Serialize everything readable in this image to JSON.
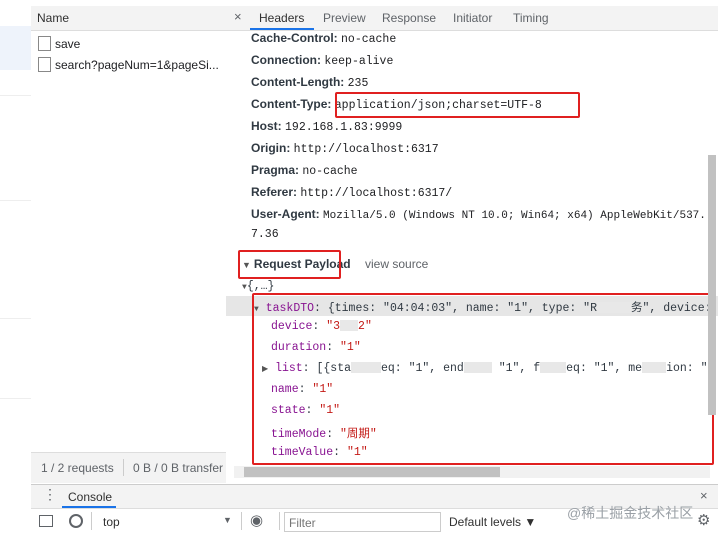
{
  "network_list": {
    "column_header": "Name",
    "requests": [
      {
        "name": "save"
      },
      {
        "name": "search?pageNum=1&pageSi..."
      }
    ],
    "footer_count": "1 / 2 requests",
    "footer_transfer": "0 B / 0 B transfer"
  },
  "tabs": [
    "Headers",
    "Preview",
    "Response",
    "Initiator",
    "Timing"
  ],
  "active_tab": "Headers",
  "close_glyph": "×",
  "headers": [
    {
      "key": "Cache-Control:",
      "value": "no-cache"
    },
    {
      "key": "Connection:",
      "value": "keep-alive"
    },
    {
      "key": "Content-Length:",
      "value": "235"
    },
    {
      "key": "Content-Type:",
      "value": "application/json;charset=UTF-8"
    },
    {
      "key": "Host:",
      "value": "192.168.1.83:9999"
    },
    {
      "key": "Origin:",
      "value": "http://localhost:6317"
    },
    {
      "key": "Pragma:",
      "value": "no-cache"
    },
    {
      "key": "Referer:",
      "value": "http://localhost:6317/"
    },
    {
      "key": "User-Agent:",
      "value": "Mozilla/5.0 (Windows NT 10.0; Win64; x64) AppleWebKit/537.",
      "value_cont": "7.36"
    }
  ],
  "payload": {
    "title": "Request Payload",
    "view_source": "view source",
    "root": "{,…}",
    "task_key": "taskDTO",
    "task_summary": "{times: \"04:04:03\", name: \"1\", type: \"R",
    "task_summary_tail": "务\", device: \"新",
    "fields": [
      {
        "key": "device",
        "value": "\"3",
        "value_tail": "2\""
      },
      {
        "key": "duration",
        "value": "\"1\""
      },
      {
        "key": "list",
        "value": "[{sta",
        "value_mid1": "eq: \"1\", end",
        "value_mid2": " \"1\", f",
        "value_mid3": "eq: \"1\", me",
        "value_mid4": "ion: \"1\""
      },
      {
        "key": "name",
        "value": "\"1\""
      },
      {
        "key": "state",
        "value": "\"1\""
      },
      {
        "key": "timeMode",
        "value": "\"周期\""
      },
      {
        "key": "timeValue",
        "value": "\"1\""
      }
    ]
  },
  "console": {
    "tab_label": "Console",
    "context": "top",
    "filter_placeholder": "Filter",
    "levels": "Default levels ▼",
    "watermark": "@稀土掘金技术社区"
  },
  "colors": {
    "highlight_box": "#e02020",
    "accent": "#1a73e8",
    "key": "#881391",
    "string": "#c41a16"
  }
}
